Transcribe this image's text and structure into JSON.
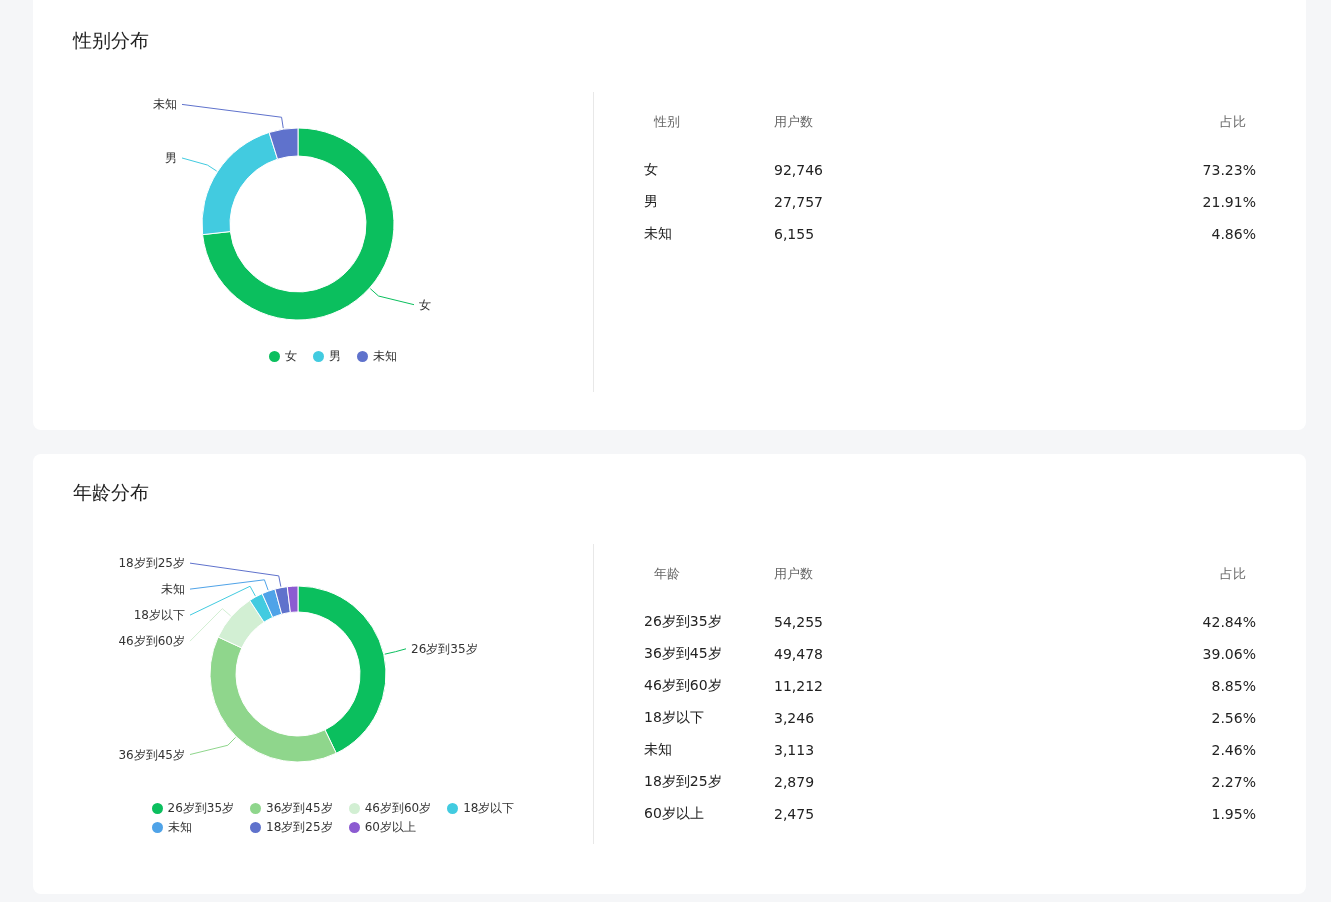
{
  "sections": [
    {
      "title": "性别分布",
      "chart_data": {
        "type": "donut",
        "categories": [
          "女",
          "男",
          "未知"
        ],
        "values": [
          73.23,
          21.91,
          4.86
        ]
      },
      "slice_labels": [
        {
          "text": "未知"
        },
        {
          "text": "男"
        },
        {
          "text": "女"
        }
      ],
      "legend": [
        {
          "color": "#0bbf5e"
        },
        {
          "color": "#42cbe0"
        },
        {
          "color": "#5f72cc"
        }
      ],
      "table": {
        "columns": [
          "性别",
          "用户数",
          "占比"
        ],
        "rows": [
          [
            "女",
            "92,746",
            "73.23%"
          ],
          [
            "男",
            "27,757",
            "21.91%"
          ],
          [
            "未知",
            "6,155",
            "4.86%"
          ]
        ]
      }
    },
    {
      "title": "年龄分布",
      "chart_data": {
        "type": "donut",
        "categories": [
          "26岁到35岁",
          "36岁到45岁",
          "46岁到60岁",
          "18岁以下",
          "未知",
          "18岁到25岁",
          "60岁以上"
        ],
        "values": [
          42.84,
          39.06,
          8.85,
          2.56,
          2.46,
          2.27,
          1.95
        ]
      },
      "slice_labels": [
        {
          "text": "18岁到25岁"
        },
        {
          "text": "未知"
        },
        {
          "text": "18岁以下"
        },
        {
          "text": "46岁到60岁"
        },
        {
          "text": "26岁到35岁"
        },
        {
          "text": "36岁到45岁"
        }
      ],
      "legend": [
        {
          "color": "#0bbf5e"
        },
        {
          "color": "#8fd68c"
        },
        {
          "color": "#d2efd3"
        },
        {
          "color": "#42cbe0"
        },
        {
          "color": "#4fa3e8"
        },
        {
          "color": "#5f72cc"
        },
        {
          "color": "#8c5bd1"
        }
      ],
      "table": {
        "columns": [
          "年龄",
          "用户数",
          "占比"
        ],
        "rows": [
          [
            "26岁到35岁",
            "54,255",
            "42.84%"
          ],
          [
            "36岁到45岁",
            "49,478",
            "39.06%"
          ],
          [
            "46岁到60岁",
            "11,212",
            "8.85%"
          ],
          [
            "18岁以下",
            "3,246",
            "2.56%"
          ],
          [
            "未知",
            "3,113",
            "2.46%"
          ],
          [
            "18岁到25岁",
            "2,879",
            "2.27%"
          ],
          [
            "60岁以上",
            "2,475",
            "1.95%"
          ]
        ]
      }
    }
  ]
}
